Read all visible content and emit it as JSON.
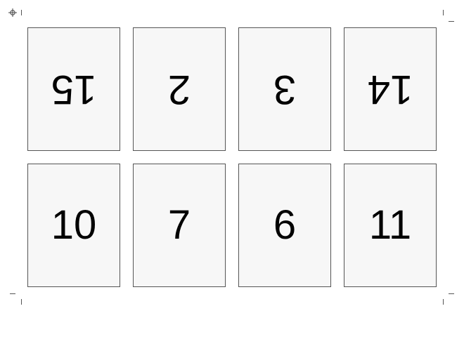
{
  "imposition_sheet": {
    "top_row": [
      {
        "page": "15",
        "rotated": true
      },
      {
        "page": "2",
        "rotated": true
      },
      {
        "page": "3",
        "rotated": true
      },
      {
        "page": "14",
        "rotated": true
      }
    ],
    "bottom_row": [
      {
        "page": "10",
        "rotated": false
      },
      {
        "page": "7",
        "rotated": false
      },
      {
        "page": "6",
        "rotated": false
      },
      {
        "page": "11",
        "rotated": false
      }
    ]
  }
}
